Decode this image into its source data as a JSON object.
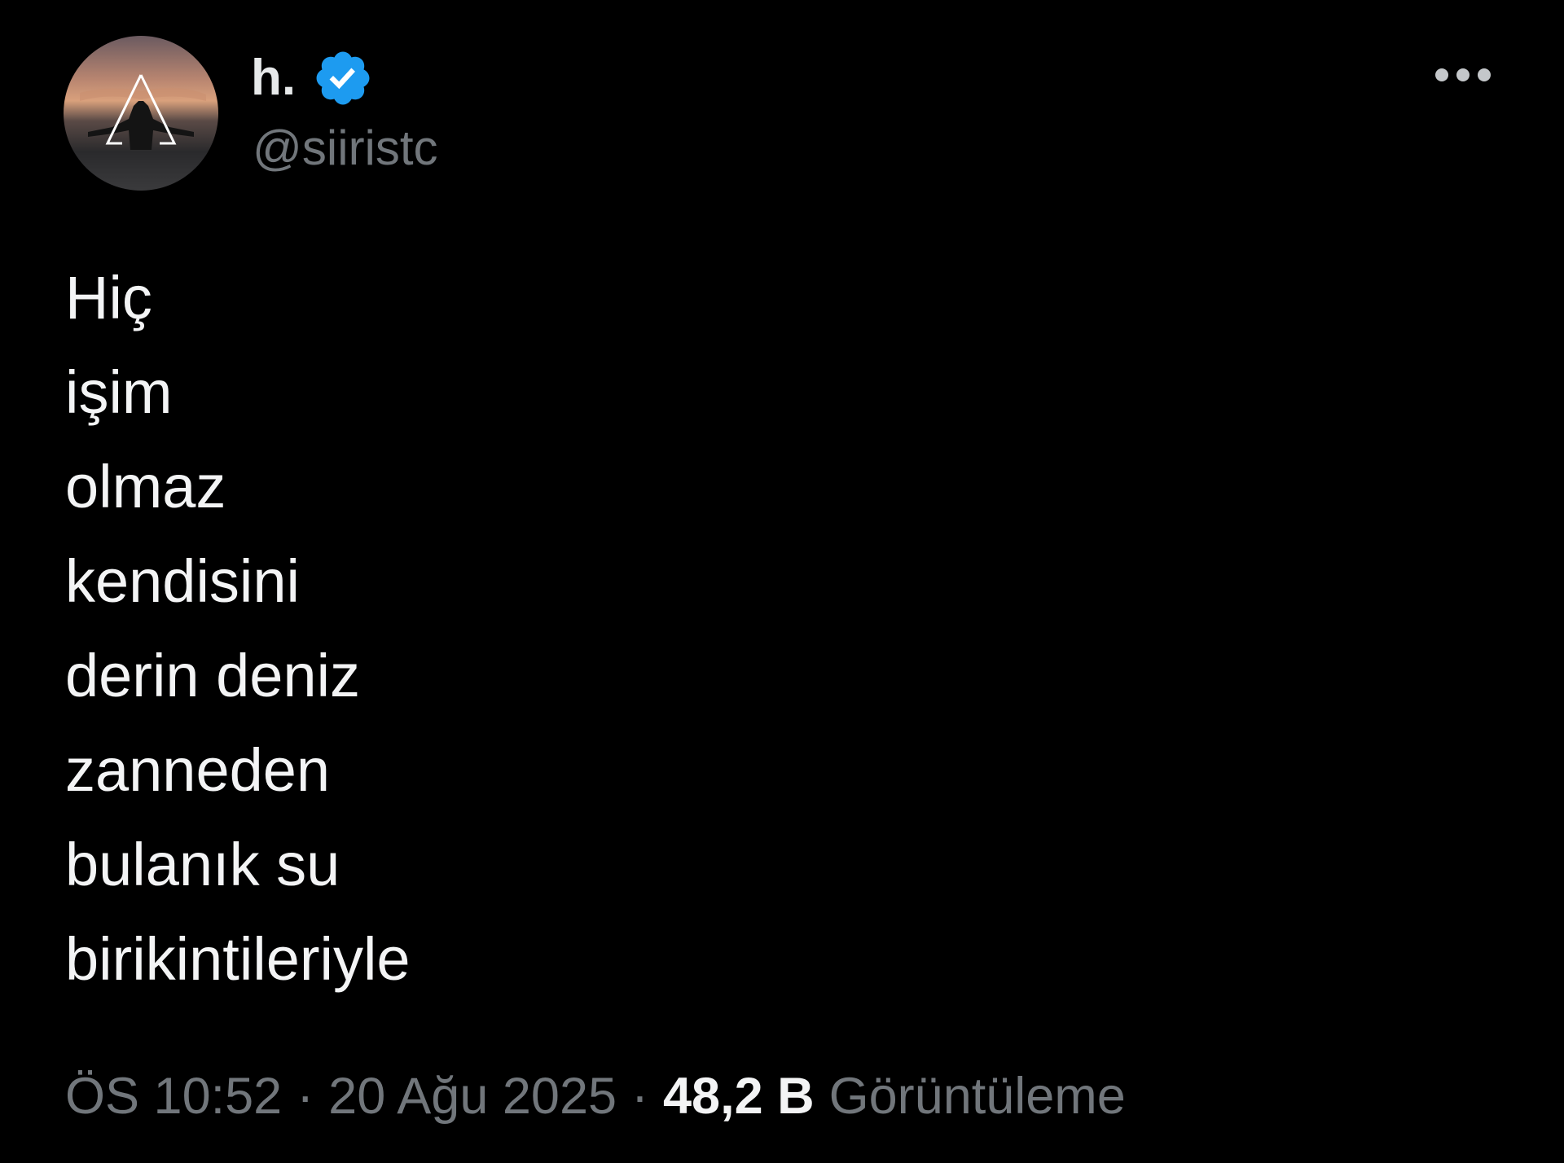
{
  "author": {
    "display_name": "h.",
    "handle": "@siiristc",
    "verified": true,
    "badge_color": "#1d9bf0",
    "avatar_icon": "avatar-silhouette-triangle"
  },
  "menu": {
    "more_icon": "more-horizontal-icon"
  },
  "tweet": {
    "lines": [
      "Hiç",
      "işim",
      "olmaz",
      "kendisini",
      "derin deniz",
      "zanneden",
      "bulanık su",
      "birikintileriyle"
    ]
  },
  "meta": {
    "time": "ÖS 10:52",
    "separator": "·",
    "date": "20 Ağu 2025",
    "views_count": "48,2 B",
    "views_label": "Görüntüleme"
  },
  "colors": {
    "background": "#000000",
    "text_primary": "#e7e9ea",
    "text_secondary": "#71767b"
  }
}
